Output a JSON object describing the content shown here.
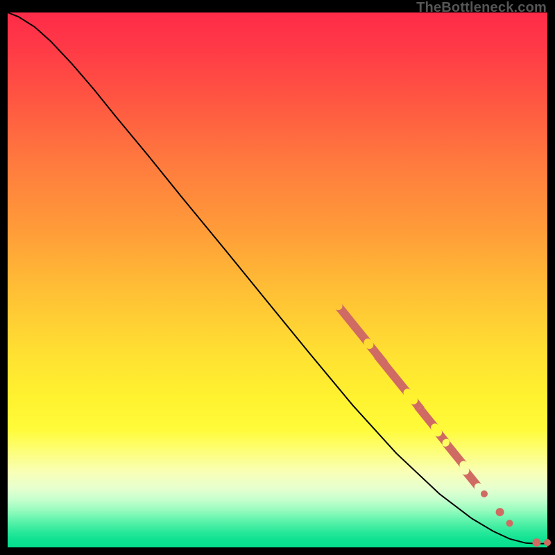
{
  "watermark": "TheBottleneck.com",
  "chart_data": {
    "type": "line",
    "title": "",
    "xlabel": "",
    "ylabel": "",
    "xlim": [
      0,
      100
    ],
    "ylim": [
      0,
      100
    ],
    "grid": false,
    "curve": [
      {
        "x": 0.0,
        "y": 100.0
      },
      {
        "x": 2.0,
        "y": 99.2
      },
      {
        "x": 5.0,
        "y": 97.3
      },
      {
        "x": 8.0,
        "y": 94.6
      },
      {
        "x": 12.0,
        "y": 90.3
      },
      {
        "x": 16.0,
        "y": 85.6
      },
      {
        "x": 20.0,
        "y": 80.6
      },
      {
        "x": 26.0,
        "y": 73.3
      },
      {
        "x": 32.0,
        "y": 65.8
      },
      {
        "x": 40.0,
        "y": 56.0
      },
      {
        "x": 48.0,
        "y": 46.1
      },
      {
        "x": 56.0,
        "y": 36.2
      },
      {
        "x": 64.0,
        "y": 26.5
      },
      {
        "x": 72.0,
        "y": 17.6
      },
      {
        "x": 80.0,
        "y": 10.0
      },
      {
        "x": 86.0,
        "y": 5.4
      },
      {
        "x": 90.0,
        "y": 3.0
      },
      {
        "x": 93.0,
        "y": 1.6
      },
      {
        "x": 96.0,
        "y": 0.8
      },
      {
        "x": 98.0,
        "y": 0.7
      },
      {
        "x": 100.0,
        "y": 0.7
      }
    ],
    "clusters": [
      {
        "x": 64.0,
        "y": 41.7,
        "len": 5.5,
        "r": 6
      },
      {
        "x": 68.5,
        "y": 36.0,
        "len": 3.0,
        "r": 6
      },
      {
        "x": 71.2,
        "y": 32.5,
        "len": 5.8,
        "r": 6
      },
      {
        "x": 76.0,
        "y": 26.5,
        "len": 1.6,
        "r": 6
      },
      {
        "x": 77.5,
        "y": 24.5,
        "len": 3.4,
        "r": 6
      },
      {
        "x": 80.5,
        "y": 20.5,
        "len": 1.6,
        "r": 6
      },
      {
        "x": 82.8,
        "y": 17.5,
        "len": 3.4,
        "r": 6
      },
      {
        "x": 86.0,
        "y": 12.8,
        "len": 2.5,
        "r": 6
      }
    ],
    "dots": [
      {
        "x": 88.3,
        "y": 10.0,
        "r": 5
      },
      {
        "x": 91.2,
        "y": 6.6,
        "r": 6
      },
      {
        "x": 93.0,
        "y": 4.5,
        "r": 5
      },
      {
        "x": 98.0,
        "y": 0.9,
        "r": 6
      },
      {
        "x": 100.0,
        "y": 0.9,
        "r": 5
      }
    ],
    "colors": {
      "curve": "#000000",
      "marker": "#cf6b62"
    }
  }
}
